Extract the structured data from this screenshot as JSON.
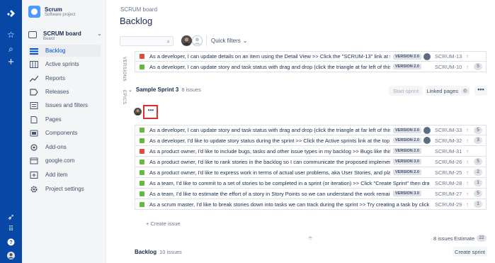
{
  "project": {
    "name": "Scrum",
    "type": "Software project"
  },
  "board": {
    "name": "SCRUM board",
    "sub": "Board"
  },
  "nav": [
    {
      "label": "Backlog",
      "icon": "backlog-icon",
      "active": true
    },
    {
      "label": "Active sprints",
      "icon": "active-sprints-icon"
    },
    {
      "label": "Reports",
      "icon": "reports-icon"
    },
    {
      "label": "Releases",
      "icon": "releases-icon"
    },
    {
      "label": "Issues and filters",
      "icon": "issues-icon"
    },
    {
      "label": "Pages",
      "icon": "pages-icon"
    },
    {
      "label": "Components",
      "icon": "components-icon"
    },
    {
      "label": "Add-ons",
      "icon": "addons-icon"
    },
    {
      "label": "google.com",
      "icon": "link-icon"
    },
    {
      "label": "Add item",
      "icon": "add-item-icon"
    },
    {
      "label": "Project settings",
      "icon": "settings-icon"
    }
  ],
  "header": {
    "breadcrumb": "SCRUM board",
    "title": "Backlog",
    "quick_filters": "Quick filters",
    "search_placeholder": ""
  },
  "side_labels": {
    "versions": "VERSIONS",
    "epics": "EPICS"
  },
  "top_rows": [
    {
      "summary": "As a developer, I can update details on an item using the Detail View >> Click the \"SCRUM-13\" link at the top right",
      "version": "VERSION 2.0",
      "key": "SCRUM-13",
      "priority": "up",
      "estimate": "",
      "type_color": "#E5493A"
    },
    {
      "summary": "As a developer, I can update story and task status with drag and drop (click the triangle at far left of this story to show sub-tasks)",
      "version": "VERSION 2.0",
      "key": "SCRUM-10",
      "priority": "up",
      "estimate": "5",
      "type_color": "#63BA3C"
    }
  ],
  "sprint": {
    "name": "Sample Sprint 3",
    "count": "8 issues",
    "start_label": "Start sprint",
    "linked_label": "Linked pages",
    "linked_count": "0",
    "more": "•••",
    "create": "+ Create issue",
    "issues_total": "8 issues",
    "estimate_label": "Estimate",
    "estimate_total": "22",
    "rows": [
      {
        "summary": "As a developer, I can update story and task status with drag and drop (click the triangle at far left of this story to show sub-tasks)",
        "version": "VERSION 2.0",
        "key": "SCRUM-33",
        "estimate": "5",
        "type_color": "#63BA3C",
        "has_avatar": true
      },
      {
        "summary": "As a developer, I'd like to update story status during the sprint >> Click the Active sprints link at the top right of the screen to go to the Active sprints",
        "version": "VERSION 2.0",
        "key": "SCRUM-32",
        "estimate": "3",
        "type_color": "#63BA3C",
        "has_avatar": true
      },
      {
        "summary": "As a product owner, I'd like to include bugs, tasks and other issue types in my backlog >> Bugs like this one will also appear in your backlog",
        "version": "VERSION 2.0",
        "key": "SCRUM-31",
        "estimate": "",
        "type_color": "#E5493A",
        "has_avatar": false
      },
      {
        "summary": "As a product owner, I'd like to rank stories in the backlog so I can communicate the proposed implementation order",
        "version": "VERSION 3.0",
        "key": "SCRUM-26",
        "estimate": "5",
        "type_color": "#63BA3C",
        "has_avatar": false
      },
      {
        "summary": "As a product owner, I'd like to express work in terms of actual user problems, aka User Stories, and place them in the backlog",
        "version": "VERSION 2.0",
        "key": "SCRUM-25",
        "estimate": "2",
        "type_color": "#63BA3C",
        "has_avatar": false
      },
      {
        "summary": "As a team, I'd like to commit to a set of stories to be completed in a sprint (or iteration) >> Click \"Create Sprint\" then drag the footer down to select issues",
        "version": "",
        "key": "SCRUM-28",
        "estimate": "1",
        "type_color": "#63BA3C",
        "has_avatar": false
      },
      {
        "summary": "As a team, I'd like to estimate the effort of a story in Story Points so we can understand the work remaining >> Try setting the Story Points",
        "version": "VERSION 3.0",
        "key": "SCRUM-27",
        "estimate": "5",
        "type_color": "#63BA3C",
        "has_avatar": false
      },
      {
        "summary": "As a scrum master, I'd like to break stories down into tasks we can track during the sprint >> Try creating a task by clicking the Sub-Tasks section",
        "version": "",
        "key": "SCRUM-29",
        "estimate": "1",
        "type_color": "#63BA3C",
        "has_avatar": false
      }
    ]
  },
  "backlog": {
    "name": "Backlog",
    "count": "10 issues",
    "create_sprint": "Create sprint"
  }
}
